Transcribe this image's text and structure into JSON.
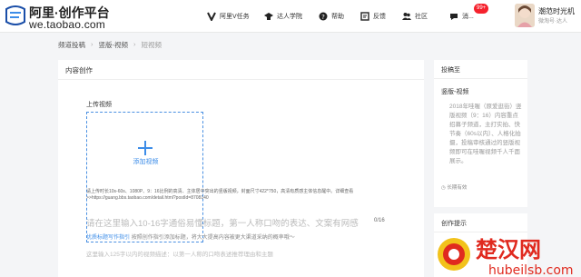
{
  "header": {
    "logo_title": "阿里·创作平台",
    "logo_sub": "we.taobao.com",
    "nav": [
      {
        "label": "阿里V任务",
        "icon": "v-icon"
      },
      {
        "label": "达人学院",
        "icon": "graduation-cap-icon"
      },
      {
        "label": "帮助",
        "icon": "help-icon"
      },
      {
        "label": "反馈",
        "icon": "feedback-icon"
      },
      {
        "label": "社区",
        "icon": "community-icon"
      },
      {
        "label": "消...",
        "icon": "message-icon"
      }
    ],
    "badge": "99+",
    "user_name": "潮范时光机",
    "user_sub": "微淘号·达人"
  },
  "breadcrumb": [
    "频道投稿",
    "竖版-视频",
    "短视频"
  ],
  "main": {
    "title": "内容创作",
    "upload_label": "上传视频",
    "upload_add": "添加视频",
    "upload_hint": "请上传时长10s-60s、1080P、9：16比例的高清、主体居中突出的竖版视频，封面尺寸422*750，高清有质感主体信息醒中。详细查看>>https://guang.bbs.taobao.com/detail.html?postId=8708140",
    "title_placeholder": "请在这里输入10-16字通俗易懂标题，第一人称口吻的表达、文案有网感",
    "title_count": "0/16",
    "guide_link": "优质标题写作指引",
    "guide_text": "按照创作指引添加标题，将大大提高内容被更大渠道采纳的概率哦～",
    "summary_placeholder": "这里输入125字以内的视频描述：以第一人称的口吻表述推荐理由和主题"
  },
  "sidebar": {
    "title": "投稿至",
    "channel": "竖版-视频",
    "desc": "2018年哇喔（原爱逛街）竖版视频（9：16）内容重点招募子频道，主打实拍、快节奏（60s以内）、人格化拍摄，投稿审核通过的竖版视频即可在哇喔视频千人千面展示。",
    "long_term": "长期有效",
    "tips_title": "创作提示"
  },
  "watermark": {
    "text1": "楚汉网",
    "text2": "hubeilsb.com"
  },
  "colors": {
    "accent": "#3d8de8",
    "badge": "#f5222d",
    "watermark": "#e02a1f"
  }
}
